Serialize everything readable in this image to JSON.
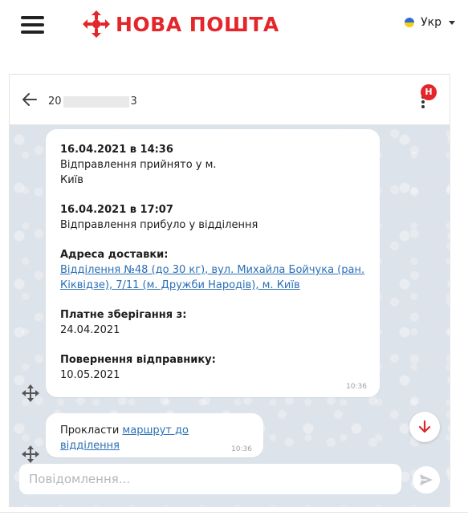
{
  "header": {
    "brand": "НОВА ПОШТА",
    "language": "Укр"
  },
  "chat": {
    "ttn_prefix": "20",
    "ttn_suffix": "3",
    "badge": "Н",
    "message1": {
      "event1_date": "16.04.2021 в 14:36",
      "event1_text": "Відправлення прийнято у м. Київ",
      "event2_date": "16.04.2021 в 17:07",
      "event2_text": "Відправлення прибуло у відділення",
      "address_label": "Адреса доставки:",
      "address_link": "Відділення №48 (до 30 кг), вул. Михайла Бойчука (ран. Кіквідзе), 7/11 (м. Дружби Народів), м. Київ",
      "storage_label": "Платне зберігання з:",
      "storage_date": "24.04.2021",
      "return_label": "Повернення відправнику:",
      "return_date": "10.05.2021",
      "time": "10:36"
    },
    "message2": {
      "text": "Прокласти",
      "link": "маршрут до відділення",
      "time": "10:36"
    },
    "input_placeholder": "Повідомлення..."
  },
  "colors": {
    "brand_red": "#e4262b",
    "link_blue": "#2a6fb6",
    "chat_bg": "#dde3ea"
  },
  "icons": [
    "menu-icon",
    "nova-poshta-logo-icon",
    "ukraine-flag-icon",
    "chevron-down-icon",
    "arrow-left-icon",
    "more-vert-icon",
    "move-icon",
    "arrow-down-icon",
    "send-icon"
  ]
}
